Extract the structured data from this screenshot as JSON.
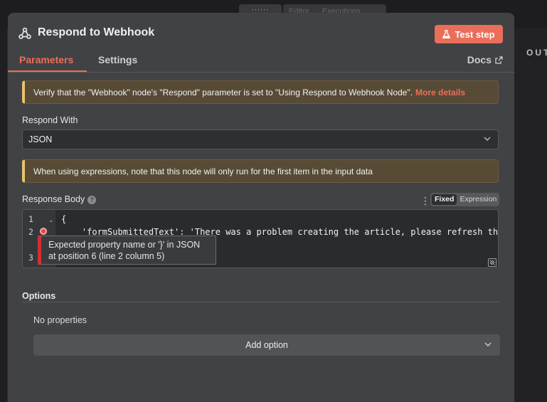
{
  "background": {
    "drag_handle": "::::::",
    "tabs": [
      "Editor",
      "Executions"
    ],
    "output_label": "OUTPUT"
  },
  "header": {
    "title": "Respond to Webhook",
    "test_button": "Test step"
  },
  "tabs": {
    "parameters": "Parameters",
    "settings": "Settings",
    "docs": "Docs"
  },
  "notice_webhook": {
    "text": "Verify that the \"Webhook\" node's \"Respond\" parameter is set to \"Using Respond to Webhook Node\".",
    "link": "More details"
  },
  "respond_with": {
    "label": "Respond With",
    "value": "JSON"
  },
  "notice_expressions": {
    "text": "When using expressions, note that this node will only run for the first item in the input data"
  },
  "response_body": {
    "label": "Response Body",
    "mode_fixed": "Fixed",
    "mode_expression": "Expression",
    "lines": [
      {
        "number": "1",
        "code": "{"
      },
      {
        "number": "2",
        "code": "    'formSubmittedText': 'There was a problem creating the article, please refresh the"
      },
      {
        "number": "3",
        "code": ""
      }
    ],
    "error_line1": "Expected property name or '}' in JSON",
    "error_line2": "at position 6 (line 2 column 5)"
  },
  "options": {
    "label": "Options",
    "empty": "No properties",
    "add_button": "Add option"
  },
  "colors": {
    "accent": "#ea6e5a",
    "warning_border": "#e8c16d",
    "error": "#d32f2f"
  }
}
